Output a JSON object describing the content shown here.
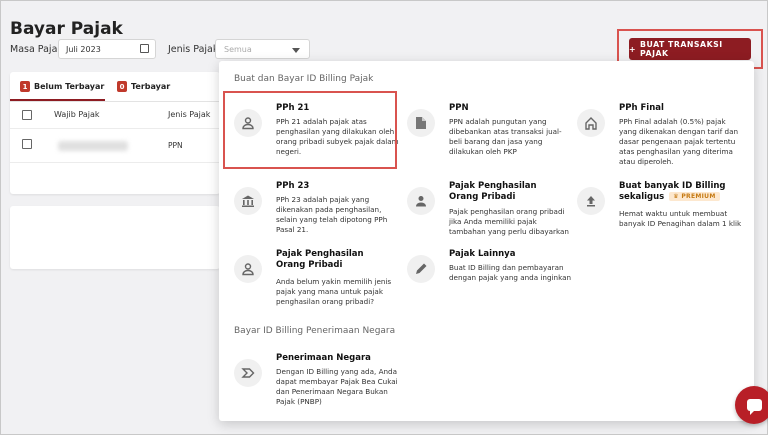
{
  "page": {
    "title": "Bayar Pajak"
  },
  "filters": {
    "masa_pajak_label": "Masa Pajak",
    "masa_pajak_value": "Juli 2023",
    "jenis_pajak_label": "Jenis Pajak",
    "jenis_pajak_placeholder": "Semua"
  },
  "toolbar": {
    "create_label": "BUAT TRANSAKSI PAJAK"
  },
  "tabs": [
    {
      "count": "1",
      "label": "Belum Terbayar"
    },
    {
      "count": "0",
      "label": "Terbayar"
    }
  ],
  "table": {
    "headers": [
      "Wajib Pajak",
      "Jenis Pajak"
    ],
    "rows": [
      {
        "jenis": "PPN"
      }
    ]
  },
  "menu": {
    "section1_title": "Buat dan Bayar ID Billing Pajak",
    "section2_title": "Bayar ID Billing Penerimaan Negara",
    "premium_badge": "PREMIUM",
    "options": [
      {
        "title": "PPh 21",
        "icon": "person-icon",
        "desc": "PPh 21 adalah pajak atas penghasilan yang dilakukan oleh orang pribadi subyek pajak dalam negeri."
      },
      {
        "title": "PPN",
        "icon": "document-icon",
        "desc": "PPN adalah pungutan yang dibebankan atas transaksi jual-beli barang dan jasa yang dilakukan oleh PKP"
      },
      {
        "title": "PPh Final",
        "icon": "home-icon",
        "desc": "PPh Final adalah (0.5%) pajak yang dikenakan dengan tarif dan dasar pengenaan pajak tertentu atas penghasilan yang diterima atau diperoleh."
      },
      {
        "title": "PPh 23",
        "icon": "bank-icon",
        "desc": "PPh 23 adalah pajak yang dikenakan pada penghasilan, selain yang telah dipotong PPh Pasal 21."
      },
      {
        "title": "Pajak Penghasilan Orang Pribadi",
        "icon": "person-icon",
        "desc": "Pajak penghasilan orang pribadi jika Anda memiliki pajak tambahan yang perlu dibayarkan"
      },
      {
        "title": "Buat banyak ID Billing sekaligus",
        "icon": "upload-icon",
        "desc": "Hemat waktu untuk membuat banyak ID Penagihan dalam 1 klik"
      },
      {
        "title": "Pajak Penghasilan Orang Pribadi",
        "icon": "person-icon",
        "desc": "Anda belum yakin memilih jenis pajak yang mana untuk pajak penghasilan orang pribadi?"
      },
      {
        "title": "Pajak Lainnya",
        "icon": "pencil-icon",
        "desc": "Buat ID Billing dan pembayaran dengan pajak yang anda inginkan"
      },
      {
        "title": "Penerimaan Negara",
        "icon": "chevron-tag-icon",
        "desc": "Dengan ID Billing yang ada, Anda dapat membayar Pajak Bea Cukai dan Penerimaan Negara Bukan Pajak (PNBP)"
      }
    ]
  },
  "colors": {
    "brand": "#8d1c22",
    "highlight": "#d9534f"
  }
}
